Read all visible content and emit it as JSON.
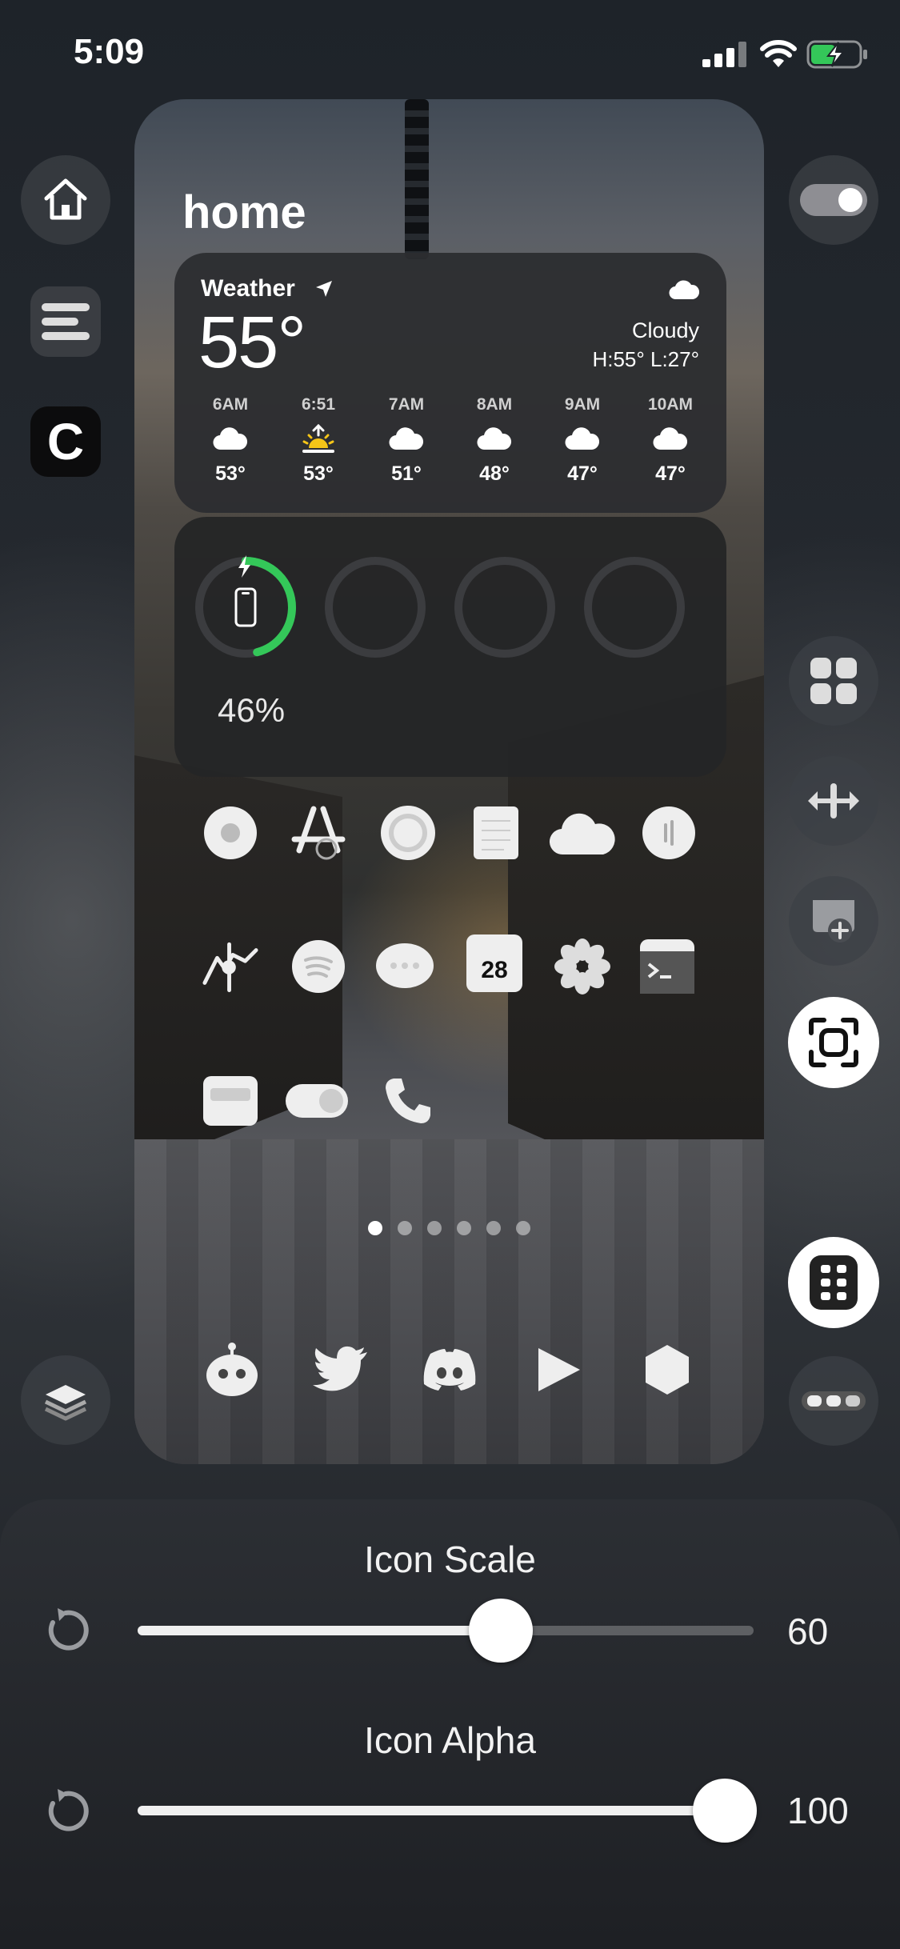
{
  "status_bar": {
    "time": "5:09",
    "icons": [
      "cellular-signal-icon",
      "wifi-icon",
      "battery-charging-icon"
    ]
  },
  "left_rail": {
    "items": [
      {
        "name": "home-icon"
      },
      {
        "name": "lines-widget-icon"
      },
      {
        "name": "c-app-icon",
        "letter": "C"
      },
      {
        "name": "layers-icon"
      }
    ]
  },
  "right_rail": {
    "items": [
      {
        "name": "toggle-icon"
      },
      {
        "name": "widgets-grid-icon"
      },
      {
        "name": "spacing-icon"
      },
      {
        "name": "add-widget-icon"
      },
      {
        "name": "screenshot-icon"
      },
      {
        "name": "app-grid-icon"
      },
      {
        "name": "more-icon"
      }
    ]
  },
  "preview": {
    "page_title": "home",
    "weather": {
      "label": "Weather",
      "temperature": "55°",
      "condition": "Cloudy",
      "high_low": "H:55° L:27°",
      "hourly": [
        {
          "time": "6AM",
          "icon": "cloud-icon",
          "temp": "53°"
        },
        {
          "time": "6:51",
          "icon": "sunrise-icon",
          "temp": "53°"
        },
        {
          "time": "7AM",
          "icon": "cloud-icon",
          "temp": "51°"
        },
        {
          "time": "8AM",
          "icon": "cloud-icon",
          "temp": "48°"
        },
        {
          "time": "9AM",
          "icon": "cloud-icon",
          "temp": "47°"
        },
        {
          "time": "10AM",
          "icon": "cloud-icon",
          "temp": "47°"
        }
      ]
    },
    "battery": {
      "percent_label": "46%",
      "level": 0.46,
      "accent": "#34c759"
    },
    "apps_row1": [
      "record-icon",
      "app-store-icon",
      "target-icon",
      "notes-icon",
      "icloud-icon",
      "voice-memo-icon"
    ],
    "apps_row2": [
      "stocks-icon",
      "spotify-icon",
      "messages-icon",
      "calendar-icon",
      "photos-icon",
      "terminal-icon"
    ],
    "apps_row3": [
      "tray-icon",
      "switch-icon",
      "phone-icon"
    ],
    "calendar_date": "28",
    "page_dots": {
      "count": 6,
      "active": 0
    },
    "dock": [
      "robot-icon",
      "twitter-icon",
      "discord-icon",
      "play-icon",
      "hexagon-icon"
    ]
  },
  "sheet": {
    "scale": {
      "title": "Icon Scale",
      "value": 60,
      "fraction": 0.59
    },
    "alpha": {
      "title": "Icon Alpha",
      "value": 100,
      "fraction": 0.953
    }
  }
}
